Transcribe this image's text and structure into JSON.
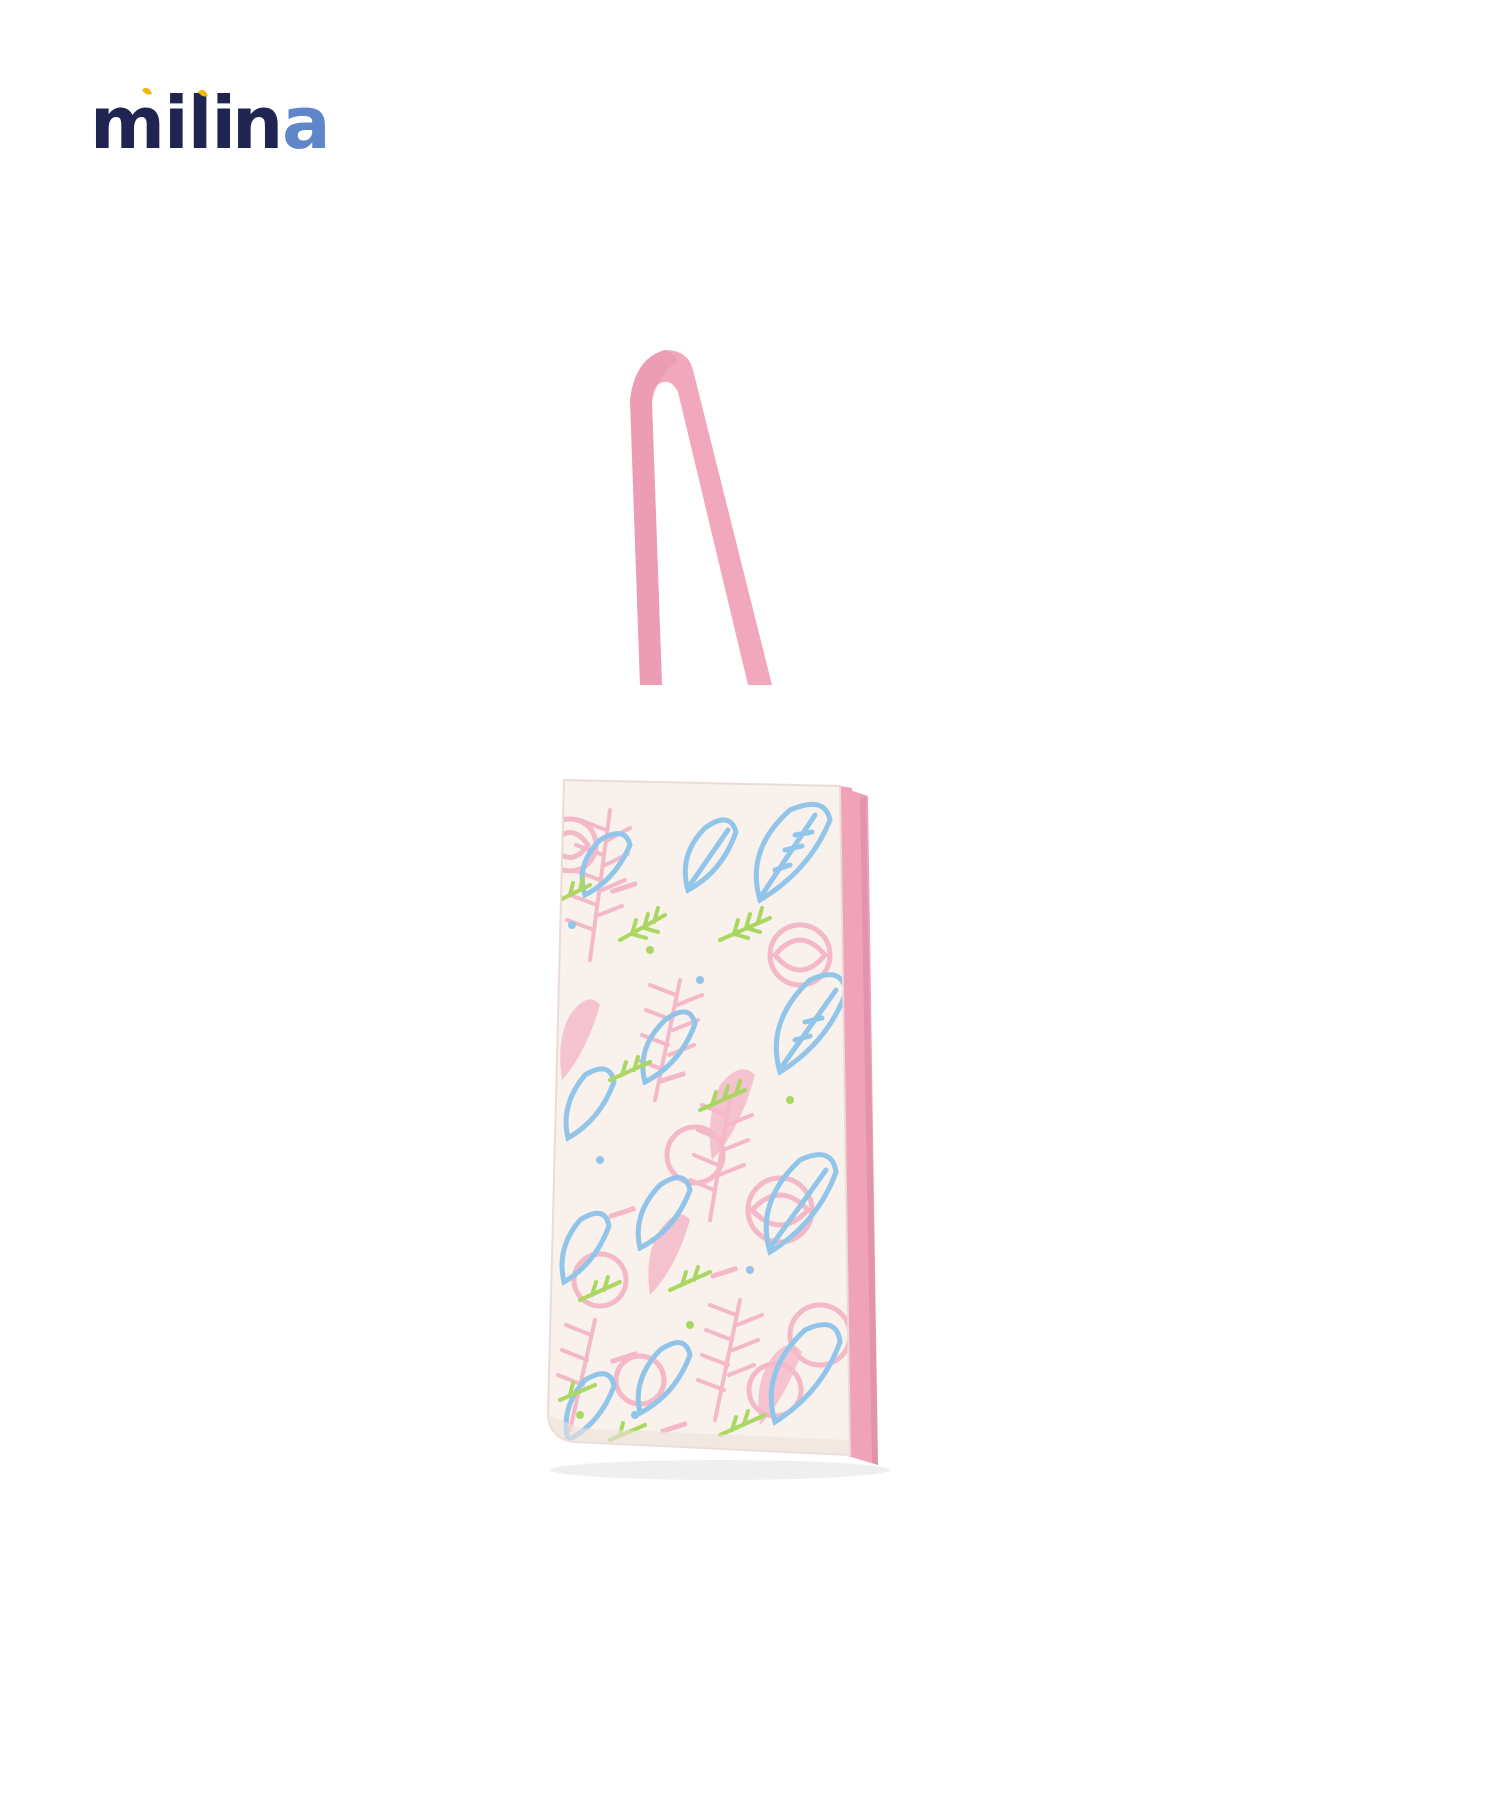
{
  "brand": {
    "name": "milina",
    "logo_text_color": "#1f2451",
    "logo_accent_color": "#5f86c9",
    "logo_dot_color": "#f2b705"
  },
  "product_photo": {
    "subject_icon": "tote-bag-icon",
    "colors": {
      "strap": "#f2a8bc",
      "strap_shadow": "#e58fa8",
      "body": "#f8f1ec",
      "side_panel": "#f0a3b8",
      "leaf_pink": "#f4b6c8",
      "leaf_blue": "#8dc2ea",
      "leaf_green": "#a6d65b"
    }
  }
}
